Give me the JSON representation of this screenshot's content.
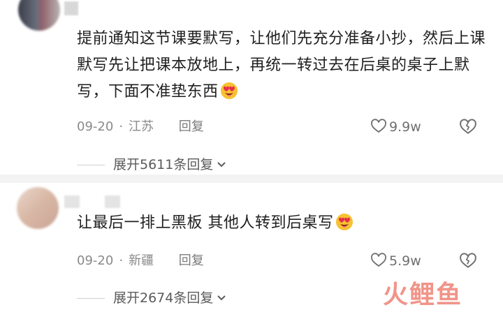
{
  "comments": [
    {
      "text": "提前通知这节课要默写，让他们先充分准备小抄，然后上课默写先让把课本放地上，再统一转过去在后桌的桌子上默写，下面不准垫东西",
      "date": "09-20",
      "location": "江苏",
      "reply_label": "回复",
      "likes": "9.9w",
      "expand_label": "展开5611条回复"
    },
    {
      "text": "让最后一排上黑板 其他人转到后桌写",
      "date": "09-20",
      "location": "新疆",
      "reply_label": "回复",
      "likes": "5.9w",
      "expand_label": "展开2674条回复"
    }
  ],
  "watermark": {
    "text": "火鲤鱼"
  },
  "icons": {
    "like": "heart-outline-icon",
    "dislike": "broken-heart-icon",
    "expand": "chevron-down-icon",
    "emoji": "heart-eyes-emoji-icon"
  },
  "colors": {
    "meta_gray": "#8a8a8a",
    "watermark": "#e63c28",
    "separator": "#f3f3f3"
  }
}
